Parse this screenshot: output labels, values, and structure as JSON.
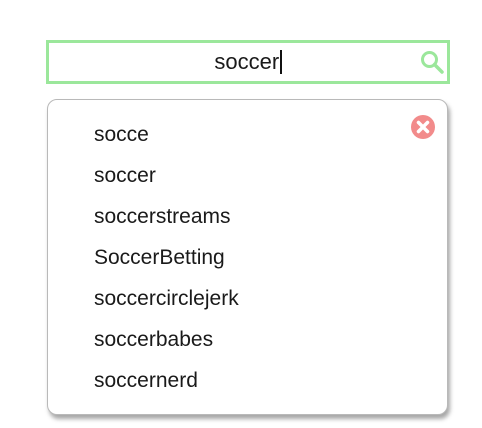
{
  "search": {
    "value": "soccer",
    "accent_color": "#9be79b",
    "icon": "search-icon"
  },
  "dropdown": {
    "close_icon": "close-icon",
    "close_color": "#f28b8b",
    "suggestions": [
      "socce",
      "soccer",
      "soccerstreams",
      "SoccerBetting",
      "soccercirclejerk",
      "soccerbabes",
      "soccernerd"
    ]
  }
}
